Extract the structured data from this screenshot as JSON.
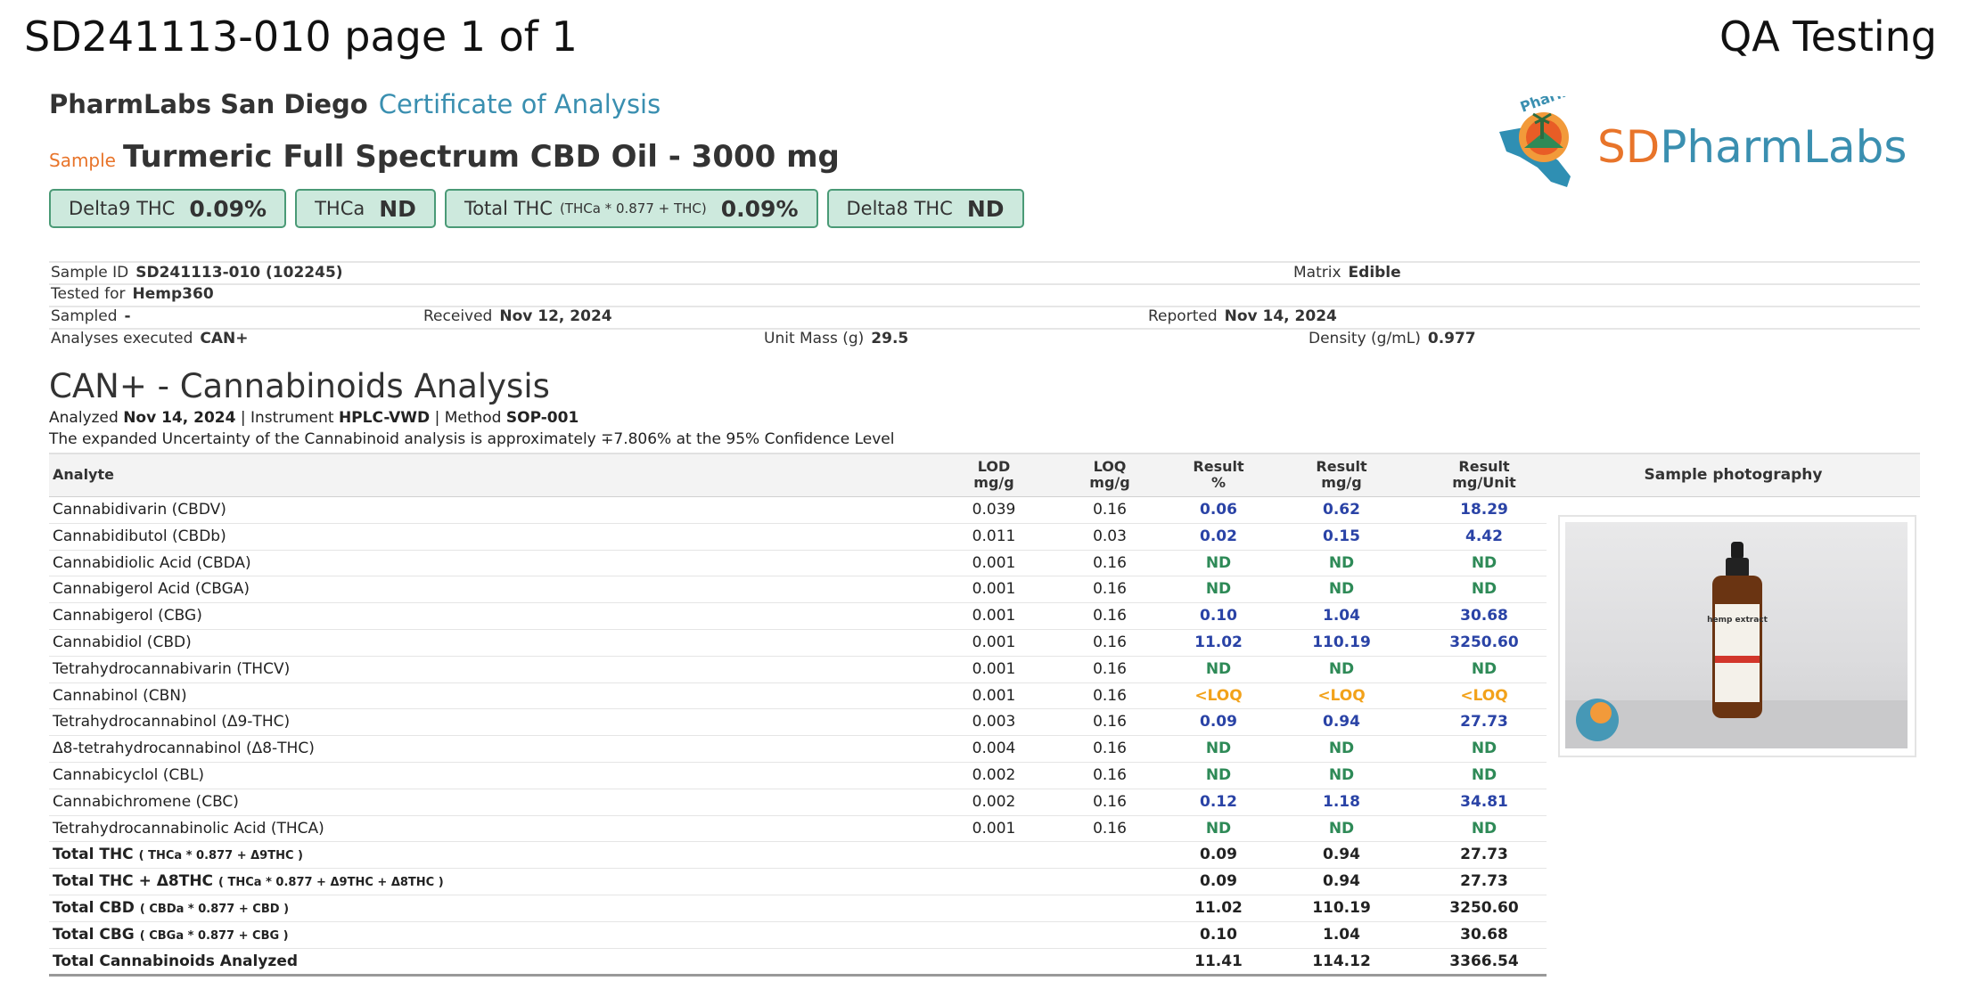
{
  "header": {
    "doc_id": "SD241113-010 page 1 of 1",
    "qa": "QA Testing"
  },
  "lab": {
    "name": "PharmLabs San Diego",
    "doc_type": "Certificate of Analysis"
  },
  "sample": {
    "label": "Sample",
    "name": "Turmeric Full Spectrum CBD Oil - 3000 mg"
  },
  "badges": [
    {
      "label": "Delta9 THC",
      "note": "",
      "value": "0.09%"
    },
    {
      "label": "THCa",
      "note": "",
      "value": "ND"
    },
    {
      "label": "Total THC",
      "note": "(THCa * 0.877 + THC)",
      "value": "0.09%"
    },
    {
      "label": "Delta8 THC",
      "note": "",
      "value": "ND"
    }
  ],
  "logo": {
    "sd": "SD",
    "pharm": "Pharm",
    "labs": "Labs",
    "emblem": "PharmLabs"
  },
  "info": {
    "sample_id_label": "Sample ID",
    "sample_id": "SD241113-010 (102245)",
    "matrix_label": "Matrix",
    "matrix": "Edible",
    "tested_for_label": "Tested for",
    "tested_for": "Hemp360",
    "sampled_label": "Sampled",
    "sampled": "-",
    "received_label": "Received",
    "received": "Nov 12, 2024",
    "reported_label": "Reported",
    "reported": "Nov 14, 2024",
    "analyses_label": "Analyses executed",
    "analyses": "CAN+",
    "unit_mass_label": "Unit Mass (g)",
    "unit_mass": "29.5",
    "density_label": "Density (g/mL)",
    "density": "0.977"
  },
  "analysis": {
    "title": "CAN+ - Cannabinoids Analysis",
    "analyzed_label": "Analyzed",
    "analyzed_date": "Nov 14, 2024",
    "instrument_label": "|  Instrument",
    "instrument": "HPLC-VWD",
    "method_label": "| Method",
    "method": "SOP-001",
    "uncertainty": "The expanded Uncertainty of the Cannabinoid analysis is approximately ∓7.806% at the 95% Confidence Level"
  },
  "table": {
    "headers": {
      "analyte": "Analyte",
      "lod": "LOD",
      "lod_unit": "mg/g",
      "loq": "LOQ",
      "loq_unit": "mg/g",
      "pct": "Result",
      "pct_unit": "%",
      "mgg": "Result",
      "mgg_unit": "mg/g",
      "mgu": "Result",
      "mgu_unit": "mg/Unit",
      "photo": "Sample photography"
    },
    "rows": [
      {
        "name": "Cannabidivarin (CBDV)",
        "lod": "0.039",
        "loq": "0.16",
        "pct": "0.06",
        "mgg": "0.62",
        "mgu": "18.29",
        "status": "blue"
      },
      {
        "name": "Cannabidibutol (CBDb)",
        "lod": "0.011",
        "loq": "0.03",
        "pct": "0.02",
        "mgg": "0.15",
        "mgu": "4.42",
        "status": "blue"
      },
      {
        "name": "Cannabidiolic Acid (CBDA)",
        "lod": "0.001",
        "loq": "0.16",
        "pct": "ND",
        "mgg": "ND",
        "mgu": "ND",
        "status": "green"
      },
      {
        "name": "Cannabigerol Acid (CBGA)",
        "lod": "0.001",
        "loq": "0.16",
        "pct": "ND",
        "mgg": "ND",
        "mgu": "ND",
        "status": "green"
      },
      {
        "name": "Cannabigerol (CBG)",
        "lod": "0.001",
        "loq": "0.16",
        "pct": "0.10",
        "mgg": "1.04",
        "mgu": "30.68",
        "status": "blue"
      },
      {
        "name": "Cannabidiol (CBD)",
        "lod": "0.001",
        "loq": "0.16",
        "pct": "11.02",
        "mgg": "110.19",
        "mgu": "3250.60",
        "status": "blue"
      },
      {
        "name": "Tetrahydrocannabivarin (THCV)",
        "lod": "0.001",
        "loq": "0.16",
        "pct": "ND",
        "mgg": "ND",
        "mgu": "ND",
        "status": "green"
      },
      {
        "name": "Cannabinol (CBN)",
        "lod": "0.001",
        "loq": "0.16",
        "pct": "<LOQ",
        "mgg": "<LOQ",
        "mgu": "<LOQ",
        "status": "orange"
      },
      {
        "name": "Tetrahydrocannabinol (Δ9-THC)",
        "lod": "0.003",
        "loq": "0.16",
        "pct": "0.09",
        "mgg": "0.94",
        "mgu": "27.73",
        "status": "blue"
      },
      {
        "name": "Δ8-tetrahydrocannabinol (Δ8-THC)",
        "lod": "0.004",
        "loq": "0.16",
        "pct": "ND",
        "mgg": "ND",
        "mgu": "ND",
        "status": "green"
      },
      {
        "name": "Cannabicyclol (CBL)",
        "lod": "0.002",
        "loq": "0.16",
        "pct": "ND",
        "mgg": "ND",
        "mgu": "ND",
        "status": "green"
      },
      {
        "name": "Cannabichromene (CBC)",
        "lod": "0.002",
        "loq": "0.16",
        "pct": "0.12",
        "mgg": "1.18",
        "mgu": "34.81",
        "status": "blue"
      },
      {
        "name": "Tetrahydrocannabinolic Acid (THCA)",
        "lod": "0.001",
        "loq": "0.16",
        "pct": "ND",
        "mgg": "ND",
        "mgu": "ND",
        "status": "green"
      }
    ],
    "totals": [
      {
        "name": "Total THC",
        "formula": "( THCa * 0.877 + Δ9THC )",
        "pct": "0.09",
        "mgg": "0.94",
        "mgu": "27.73"
      },
      {
        "name": "Total THC + Δ8THC",
        "formula": "( THCa * 0.877 + Δ9THC + Δ8THC )",
        "pct": "0.09",
        "mgg": "0.94",
        "mgu": "27.73"
      },
      {
        "name": "Total CBD",
        "formula": "( CBDa * 0.877 + CBD )",
        "pct": "11.02",
        "mgg": "110.19",
        "mgu": "3250.60"
      },
      {
        "name": "Total CBG",
        "formula": "( CBGa * 0.877 + CBG )",
        "pct": "0.10",
        "mgg": "1.04",
        "mgu": "30.68"
      },
      {
        "name": "Total Cannabinoids Analyzed",
        "formula": "",
        "pct": "11.41",
        "mgg": "114.12",
        "mgu": "3366.54"
      }
    ]
  },
  "photo": {
    "product": "hemp extract"
  },
  "colors": {
    "accent_blue": "#3a8fb0",
    "sample_orange": "#e8742a",
    "badge_bg": "#cde9dd",
    "value_blue": "#2a43a6",
    "nd_green": "#2e8a57",
    "loq_orange": "#f2a21b"
  }
}
